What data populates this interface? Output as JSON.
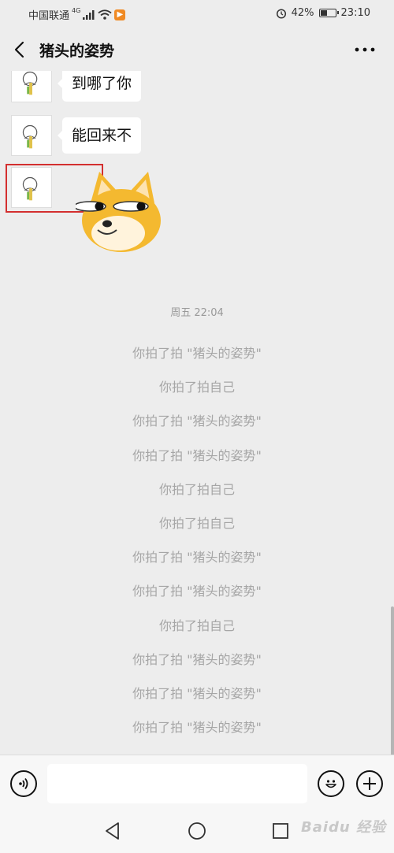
{
  "status_bar": {
    "carrier": "中国联通",
    "network": "4G",
    "battery": "42%",
    "battery_level": 0.42,
    "time": "23:10"
  },
  "header": {
    "title": "猪头的姿势",
    "back_icon": "chevron-left-icon",
    "more_icon": "more-dots-icon"
  },
  "messages": [
    {
      "text": "到哪了你"
    },
    {
      "text": "能回来不"
    }
  ],
  "timestamp": "周五 22:04",
  "system_messages": [
    "你拍了拍 \"猪头的姿势\"",
    "你拍了拍自己",
    "你拍了拍 \"猪头的姿势\"",
    "你拍了拍 \"猪头的姿势\"",
    "你拍了拍自己",
    "你拍了拍自己",
    "你拍了拍 \"猪头的姿势\"",
    "你拍了拍 \"猪头的姿势\"",
    "你拍了拍自己",
    "你拍了拍 \"猪头的姿势\"",
    "你拍了拍 \"猪头的姿势\"",
    "你拍了拍 \"猪头的姿势\""
  ],
  "input_bar": {
    "voice_icon": "voice-icon",
    "emoji_icon": "emoji-icon",
    "add_icon": "plus-icon",
    "placeholder": ""
  },
  "watermark": "Baidu 经验",
  "colors": {
    "background": "#ededed",
    "bubble": "#ffffff",
    "highlight": "#d32f2f",
    "system_text": "#a6a6a6"
  }
}
